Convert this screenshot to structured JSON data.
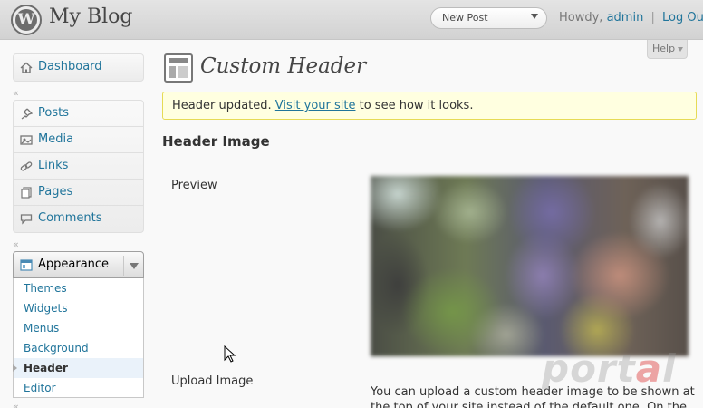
{
  "header": {
    "site_title": "My Blog",
    "new_post_label": "New Post",
    "howdy_prefix": "Howdy,",
    "username": "admin",
    "separator": "|",
    "logout_label": "Log Out"
  },
  "sidebar": {
    "dashboard": "Dashboard",
    "content_items": [
      {
        "label": "Posts",
        "icon": "pin-icon"
      },
      {
        "label": "Media",
        "icon": "media-icon"
      },
      {
        "label": "Links",
        "icon": "link-icon"
      },
      {
        "label": "Pages",
        "icon": "pages-icon"
      },
      {
        "label": "Comments",
        "icon": "comment-icon"
      }
    ],
    "appearance": {
      "label": "Appearance",
      "submenu": [
        "Themes",
        "Widgets",
        "Menus",
        "Background",
        "Header",
        "Editor"
      ],
      "current": "Header"
    }
  },
  "main": {
    "help_label": "Help",
    "page_title": "Custom Header",
    "notice": {
      "before": "Header updated.",
      "link": "Visit your site",
      "after": "to see how it looks."
    },
    "section_title": "Header Image",
    "preview_label": "Preview",
    "upload_label": "Upload Image",
    "upload_text": "You can upload a custom header image to be shown at the top of your site instead of the default one. On the"
  },
  "watermark": "portal",
  "colors": {
    "link": "#21759b",
    "notice_bg": "#ffffe0",
    "notice_border": "#e6db55"
  }
}
